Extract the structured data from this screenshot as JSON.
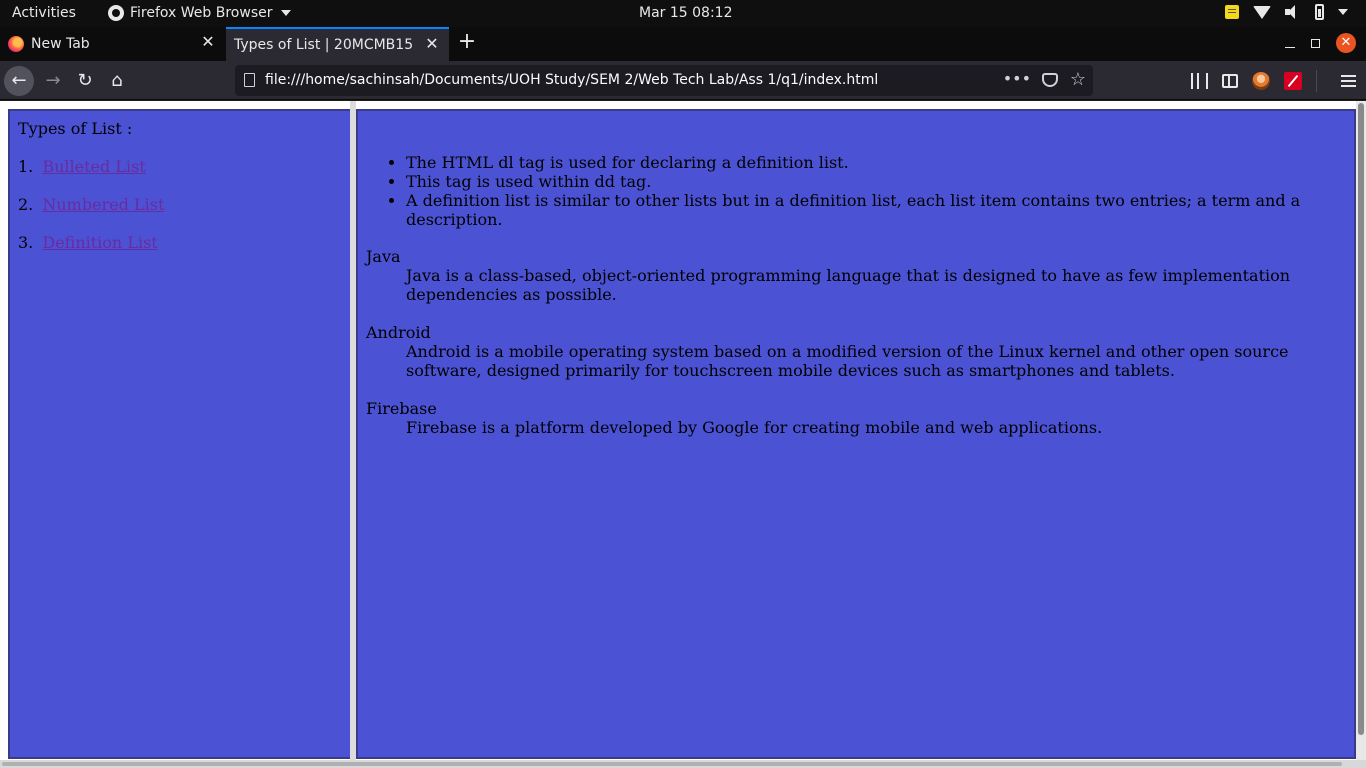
{
  "system_bar": {
    "activities": "Activities",
    "app_name": "Firefox Web Browser",
    "clock": "Mar 15  08:12"
  },
  "tabs": [
    {
      "title": "New Tab",
      "active": false
    },
    {
      "title": "Types of List | 20MCMB15",
      "active": true
    }
  ],
  "url": "file:///home/sachinsah/Documents/UOH Study/SEM 2/Web Tech Lab/Ass 1/q1/index.html",
  "left_frame": {
    "heading": "Types of List :",
    "items": [
      {
        "number": "1.",
        "label": "Bulleted List"
      },
      {
        "number": "2.",
        "label": "Numbered List"
      },
      {
        "number": "3.",
        "label": "Definition List"
      }
    ]
  },
  "right_frame": {
    "bullets": [
      "The HTML dl tag is used for declaring a definition list.",
      "This tag is used within dd tag.",
      "A definition list is similar to other lists but in a definition list, each list item contains two entries; a term and a description."
    ],
    "definitions": [
      {
        "term": "Java",
        "desc": "Java is a class-based, object-oriented programming language that is designed to have as few implementation dependencies as possible."
      },
      {
        "term": "Android",
        "desc": "Android is a mobile operating system based on a modified version of the Linux kernel and other open source software, designed primarily for touchscreen mobile devices such as smartphones and tablets."
      },
      {
        "term": "Firebase",
        "desc": "Firebase is a platform developed by Google for creating mobile and web applications."
      }
    ]
  },
  "colors": {
    "frame_bg": "#4b53d4",
    "link": "#6a2aa0",
    "tab_accent": "#0a84ff",
    "window_close": "#e95420"
  }
}
